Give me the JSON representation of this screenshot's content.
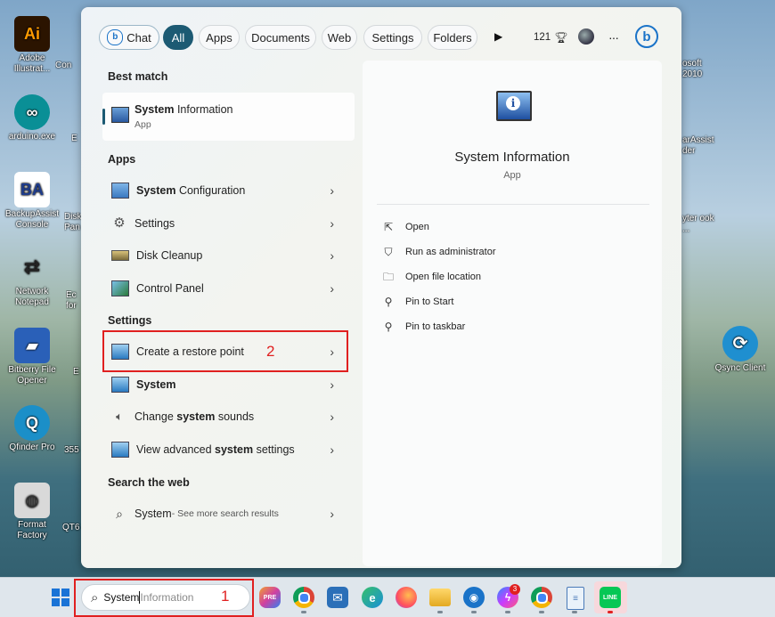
{
  "desktop": {
    "left_icons": [
      {
        "label": "Adobe Illustrat...",
        "color": "#2b1400",
        "glyph": "Ai",
        "glyph_color": "#ff9a00"
      },
      {
        "label": "arduino.exe",
        "color": "#0a8f96",
        "glyph": "∞",
        "glyph_color": "#ffffff"
      },
      {
        "label": "BackupAssist Console",
        "color": "#ffffff",
        "glyph": "BA",
        "glyph_color": "#1e3c8c"
      },
      {
        "label": "Network Notepad",
        "color": "#e6e6e6",
        "glyph": "⇄",
        "glyph_color": "#222222"
      },
      {
        "label": "Bitberry File Opener",
        "color": "#2a60b8",
        "glyph": "▰",
        "glyph_color": "#ffffff"
      },
      {
        "label": "Qfinder Pro",
        "color": "#1b8fc8",
        "glyph": "Q",
        "glyph_color": "#ffffff"
      },
      {
        "label": "Format Factory",
        "color": "#d9d9d9",
        "glyph": "◍",
        "glyph_color": "#333333"
      }
    ],
    "partial_left": [
      "Con",
      "E",
      "Disk Pan",
      "Ec for",
      "E",
      "355",
      "QT6"
    ],
    "partial_right": [
      "osoft 2010",
      "arAssist der",
      "yter ook ..."
    ],
    "qsync_label": "Qsync Client"
  },
  "start_menu": {
    "filters": [
      "Chat",
      "All",
      "Apps",
      "Documents",
      "Web",
      "Settings",
      "Folders"
    ],
    "active_filter": "All",
    "points": "121",
    "more": "···",
    "best_match_title": "Best match",
    "best_match": {
      "name_bold": "System",
      "name_rest": " Information",
      "type": "App"
    },
    "apps_title": "Apps",
    "apps": [
      {
        "bold": "System",
        "rest": " Configuration",
        "icon": "monitor-config-icon"
      },
      {
        "bold": "",
        "rest": "Settings",
        "icon": "gear-icon"
      },
      {
        "bold": "",
        "rest": "Disk Cleanup",
        "icon": "disk-cleanup-icon"
      },
      {
        "bold": "",
        "rest": "Control Panel",
        "icon": "control-panel-icon"
      }
    ],
    "settings_title": "Settings",
    "settings": [
      {
        "pre": "Create a restore point",
        "bold": "",
        "post": "",
        "icon": "restore-icon"
      },
      {
        "pre": "",
        "bold": "System",
        "post": "",
        "icon": "system-icon"
      },
      {
        "pre": "Change ",
        "bold": "system",
        "post": " sounds",
        "icon": "speaker-icon"
      },
      {
        "pre": "View advanced ",
        "bold": "system",
        "post": " settings",
        "icon": "advanced-icon"
      }
    ],
    "web_title": "Search the web",
    "web": {
      "query": "System",
      "suffix": " - See more search results"
    },
    "annotation_2": "2",
    "preview": {
      "title": "System Information",
      "type": "App",
      "actions": [
        "Open",
        "Run as administrator",
        "Open file location",
        "Pin to Start",
        "Pin to taskbar"
      ]
    }
  },
  "taskbar": {
    "search_typed": "System",
    "search_suggest": "Information",
    "annotation_1": "1",
    "messenger_badge": "3",
    "line_label": "LINE"
  },
  "colors": {
    "annotation": "#e02020",
    "active_pill": "#1c5a73",
    "accent": "#1a73c8"
  }
}
